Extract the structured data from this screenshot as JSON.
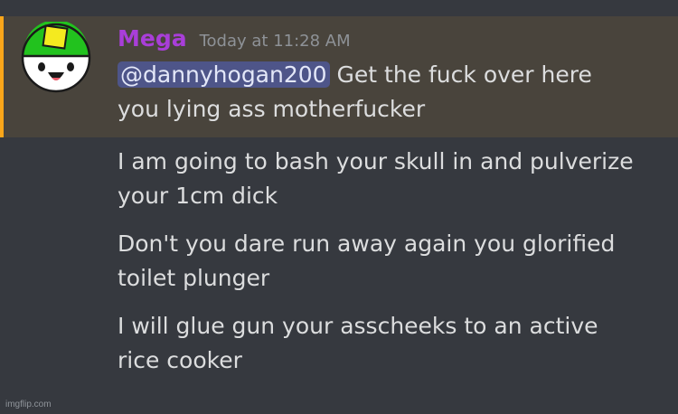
{
  "message_group": {
    "author": {
      "name": "Mega",
      "name_color": "#a93ed9",
      "avatar": "green-cap-smiley-avatar"
    },
    "timestamp": "Today at 11:28 AM",
    "highlight_color": "#faa61a",
    "messages": [
      {
        "mention": "@dannyhogan200",
        "text_line1": " Get the fuck over here",
        "text_line2": "you lying ass motherfucker"
      },
      {
        "text_line1": "I am going to bash your skull in and pulverize",
        "text_line2": "your 1cm dick"
      },
      {
        "text_line1": "Don't you dare run away again you glorified",
        "text_line2": "toilet plunger"
      },
      {
        "text_line1": "I will glue gun your asscheeks to an active",
        "text_line2": "rice cooker"
      }
    ]
  },
  "watermark": "imgflip.com"
}
